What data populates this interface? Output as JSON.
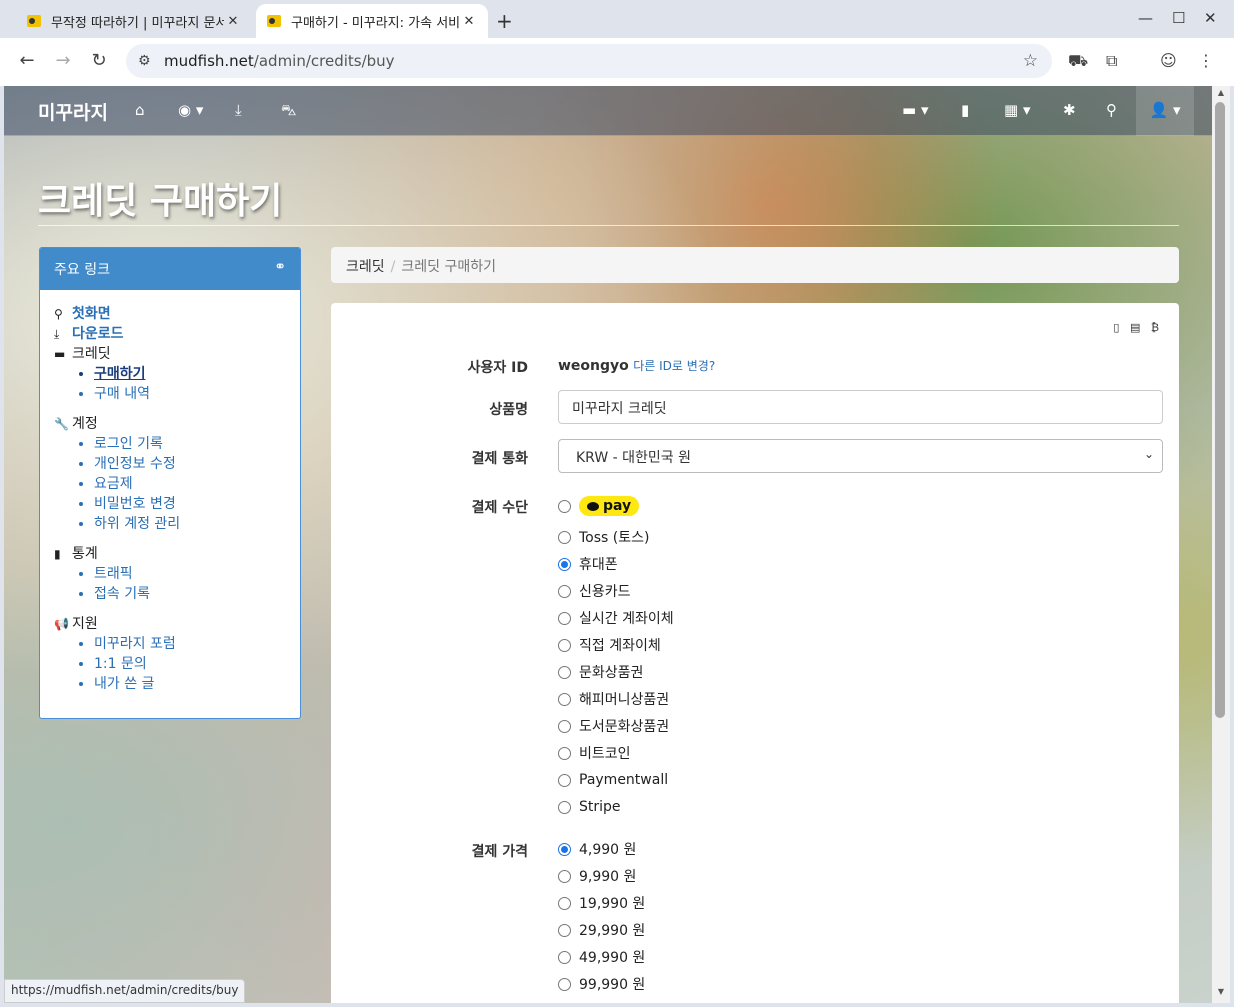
{
  "browser": {
    "tabs": [
      {
        "title": "무작정 따라하기 | 미꾸라지 문서",
        "active": false
      },
      {
        "title": "구매하기 - 미꾸라지: 가속 서비스",
        "active": true
      }
    ],
    "url_host": "mudfish.net",
    "url_path": "/admin/credits/buy",
    "status_url": "https://mudfish.net/admin/credits/buy"
  },
  "site": {
    "brand": "미꾸라지",
    "page_title": "크레딧 구매하기"
  },
  "sidebar": {
    "title": "주요 링크",
    "home": "첫화면",
    "download": "다운로드",
    "groups": [
      {
        "label": "크레딧",
        "items": [
          "구매하기",
          "구매 내역"
        ]
      },
      {
        "label": "계정",
        "items": [
          "로그인 기록",
          "개인정보 수정",
          "요금제",
          "비밀번호 변경",
          "하위 계정 관리"
        ]
      },
      {
        "label": "통계",
        "items": [
          "트래픽",
          "접속 기록"
        ]
      },
      {
        "label": "지원",
        "items": [
          "미꾸라지 포럼",
          "1:1 문의",
          "내가 쓴 글"
        ]
      }
    ]
  },
  "breadcrumb": {
    "root": "크레딧",
    "current": "크레딧 구매하기"
  },
  "form": {
    "user_label": "사용자 ID",
    "user_id": "weongyo",
    "change_id": "다른 ID로 변경?",
    "product_label": "상품명",
    "product_value": "미꾸라지 크레딧",
    "currency_label": "결제 통화",
    "currency_value": "KRW - 대한민국 원",
    "method_label": "결제 수단",
    "methods": [
      "pay",
      "Toss (토스)",
      "휴대폰",
      "신용카드",
      "실시간 계좌이체",
      "직접 계좌이체",
      "문화상품권",
      "해피머니상품권",
      "도서문화상품권",
      "비트코인",
      "Paymentwall",
      "Stripe"
    ],
    "method_selected": "휴대폰",
    "price_label": "결제 가격",
    "prices": [
      "4,990 원",
      "9,990 원",
      "19,990 원",
      "29,990 원",
      "49,990 원",
      "99,990 원"
    ],
    "price_selected": "4,990 원"
  },
  "colors": {
    "accent": "#428bca",
    "kakao": "#ffe812",
    "radio": "#1a73e8"
  }
}
